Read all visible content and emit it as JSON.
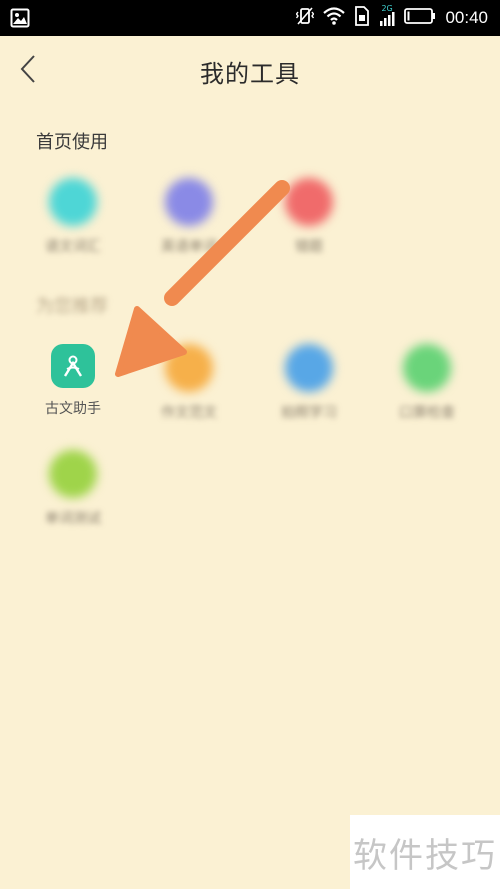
{
  "status_bar": {
    "time": "00:40",
    "network": "2G"
  },
  "header": {
    "title": "我的工具"
  },
  "sections": [
    {
      "title": "首页使用"
    },
    {
      "title": "为您推荐"
    }
  ],
  "home_tools": [
    {
      "label": "语文词汇",
      "color": "#4ed6d6"
    },
    {
      "label": "英语单词",
      "color": "#8a8ae6"
    },
    {
      "label": "错题",
      "color": "#f06b6b"
    }
  ],
  "recommend_tools": [
    {
      "label": "古文助手",
      "color": "#2ec29a"
    },
    {
      "label": "作文范文",
      "color": "#f6b04a"
    },
    {
      "label": "拍照学习",
      "color": "#58a7e6"
    },
    {
      "label": "口算检查",
      "color": "#6ad47a"
    },
    {
      "label": "单词测试",
      "color": "#9fd44a"
    }
  ],
  "annotation": {
    "arrow_color": "#f08a4f"
  },
  "watermark": {
    "text": "软件技巧"
  }
}
